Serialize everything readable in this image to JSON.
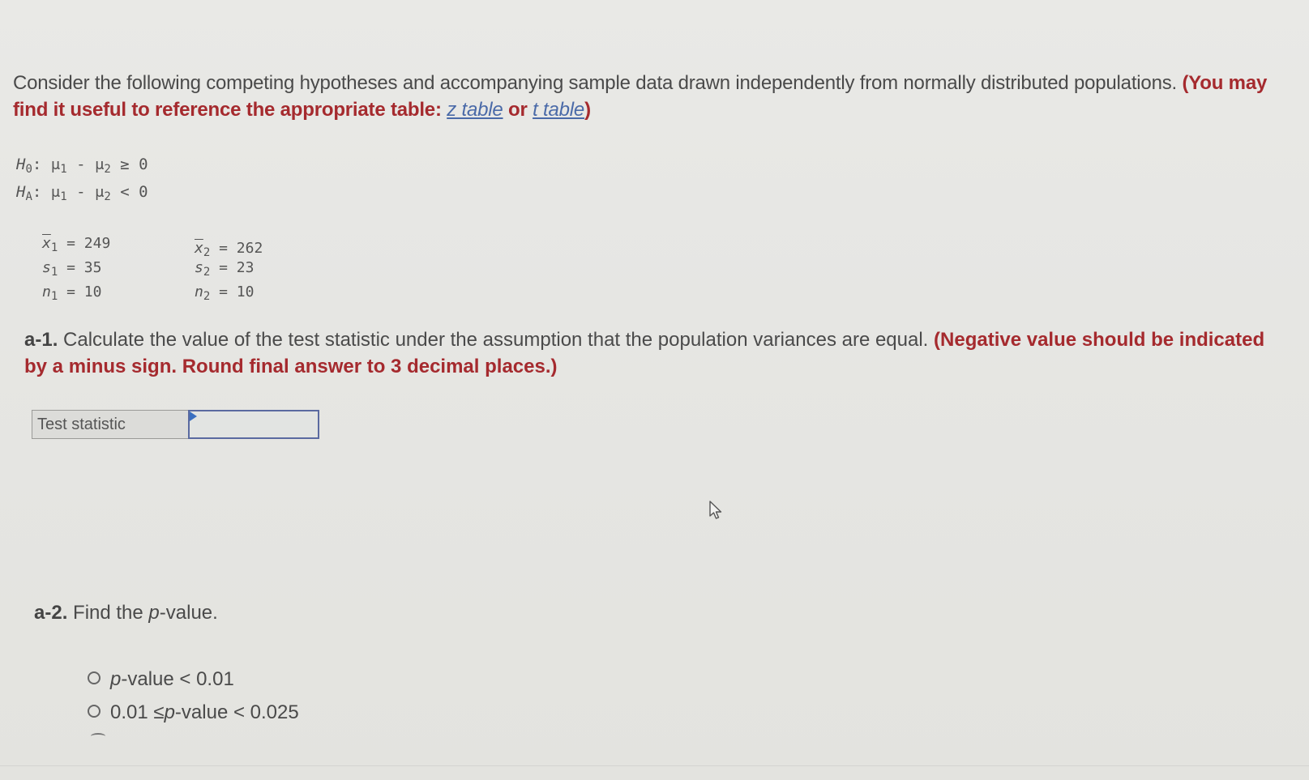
{
  "intro": {
    "text": "Consider the following competing hypotheses and accompanying sample data drawn independently from normally distributed populations.",
    "hint_prefix": "(You may find it useful to reference the appropriate table:",
    "z_table_link": "z table",
    "or_text": "or",
    "t_table_link": "t table",
    "hint_suffix": ")"
  },
  "hypotheses": {
    "null": {
      "label": "H",
      "sub": "0",
      "expr_a": ": μ",
      "sub1": "1",
      "expr_b": " - μ",
      "sub2": "2",
      "relation": " ≥ 0"
    },
    "alt": {
      "label": "H",
      "sub": "A",
      "expr_a": ": μ",
      "sub1": "1",
      "expr_b": " - μ",
      "sub2": "2",
      "relation": " < 0"
    }
  },
  "sample1": {
    "xbar_label": "x",
    "xbar_sub": "1",
    "xbar_value": " = 249",
    "s_label": "s",
    "s_sub": "1",
    "s_value": " = 35",
    "n_label": "n",
    "n_sub": "1",
    "n_value": " = 10"
  },
  "sample2": {
    "xbar_label": "x",
    "xbar_sub": "2",
    "xbar_value": " = 262",
    "s_label": "s",
    "s_sub": "2",
    "s_value": " = 23",
    "n_label": "n",
    "n_sub": "2",
    "n_value": " = 10"
  },
  "question_a1": {
    "label": "a-1.",
    "text": "Calculate the value of the test statistic under the assumption that the population variances are equal.",
    "hint": "(Negative value should be indicated by a minus sign. Round final answer to 3 decimal places.)"
  },
  "answer": {
    "label": "Test statistic",
    "value": ""
  },
  "question_a2": {
    "label": "a-2.",
    "text_before": "Find the ",
    "text_italic": "p",
    "text_after": "-value."
  },
  "options": [
    {
      "before": "",
      "italic": "p",
      "after": "-value < 0.01"
    },
    {
      "before": "0.01 ≤ ",
      "italic": "p",
      "after": "-value < 0.025"
    }
  ]
}
